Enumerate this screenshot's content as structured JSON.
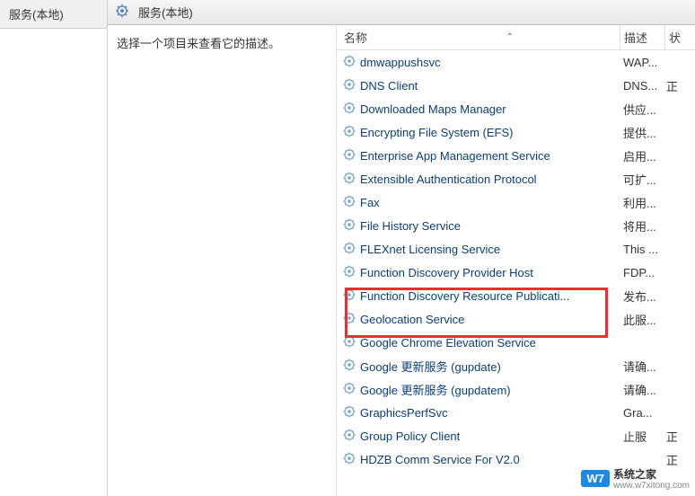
{
  "leftPanel": {
    "label": "服务(本地)"
  },
  "header": {
    "title": "服务(本地)"
  },
  "description": {
    "text": "选择一个项目来查看它的描述。"
  },
  "columns": {
    "name": "名称",
    "desc": "描述",
    "status": "状"
  },
  "services": [
    {
      "name": "dmwappushsvc",
      "desc": "WAP...",
      "status": ""
    },
    {
      "name": "DNS Client",
      "desc": "DNS...",
      "status": "正"
    },
    {
      "name": "Downloaded Maps Manager",
      "desc": "供应...",
      "status": ""
    },
    {
      "name": "Encrypting File System (EFS)",
      "desc": "提供...",
      "status": ""
    },
    {
      "name": "Enterprise App Management Service",
      "desc": "启用...",
      "status": ""
    },
    {
      "name": "Extensible Authentication Protocol",
      "desc": "可扩...",
      "status": ""
    },
    {
      "name": "Fax",
      "desc": "利用...",
      "status": ""
    },
    {
      "name": "File History Service",
      "desc": "将用...",
      "status": ""
    },
    {
      "name": "FLEXnet Licensing Service",
      "desc": "This ...",
      "status": ""
    },
    {
      "name": "Function Discovery Provider Host",
      "desc": "FDP...",
      "status": ""
    },
    {
      "name": "Function Discovery Resource Publicati...",
      "desc": "发布...",
      "status": ""
    },
    {
      "name": "Geolocation Service",
      "desc": "此服...",
      "status": ""
    },
    {
      "name": "Google Chrome Elevation Service",
      "desc": "",
      "status": ""
    },
    {
      "name": "Google 更新服务 (gupdate)",
      "desc": "请确...",
      "status": ""
    },
    {
      "name": "Google 更新服务 (gupdatem)",
      "desc": "请确...",
      "status": ""
    },
    {
      "name": "GraphicsPerfSvc",
      "desc": "Gra...",
      "status": ""
    },
    {
      "name": "Group Policy Client",
      "desc": "止服",
      "status": "正"
    },
    {
      "name": "HDZB Comm Service For V2.0",
      "desc": "",
      "status": "正"
    }
  ],
  "watermark": {
    "badge": "W7",
    "brand": "系统之家",
    "url": "www.w7xitong.com"
  }
}
